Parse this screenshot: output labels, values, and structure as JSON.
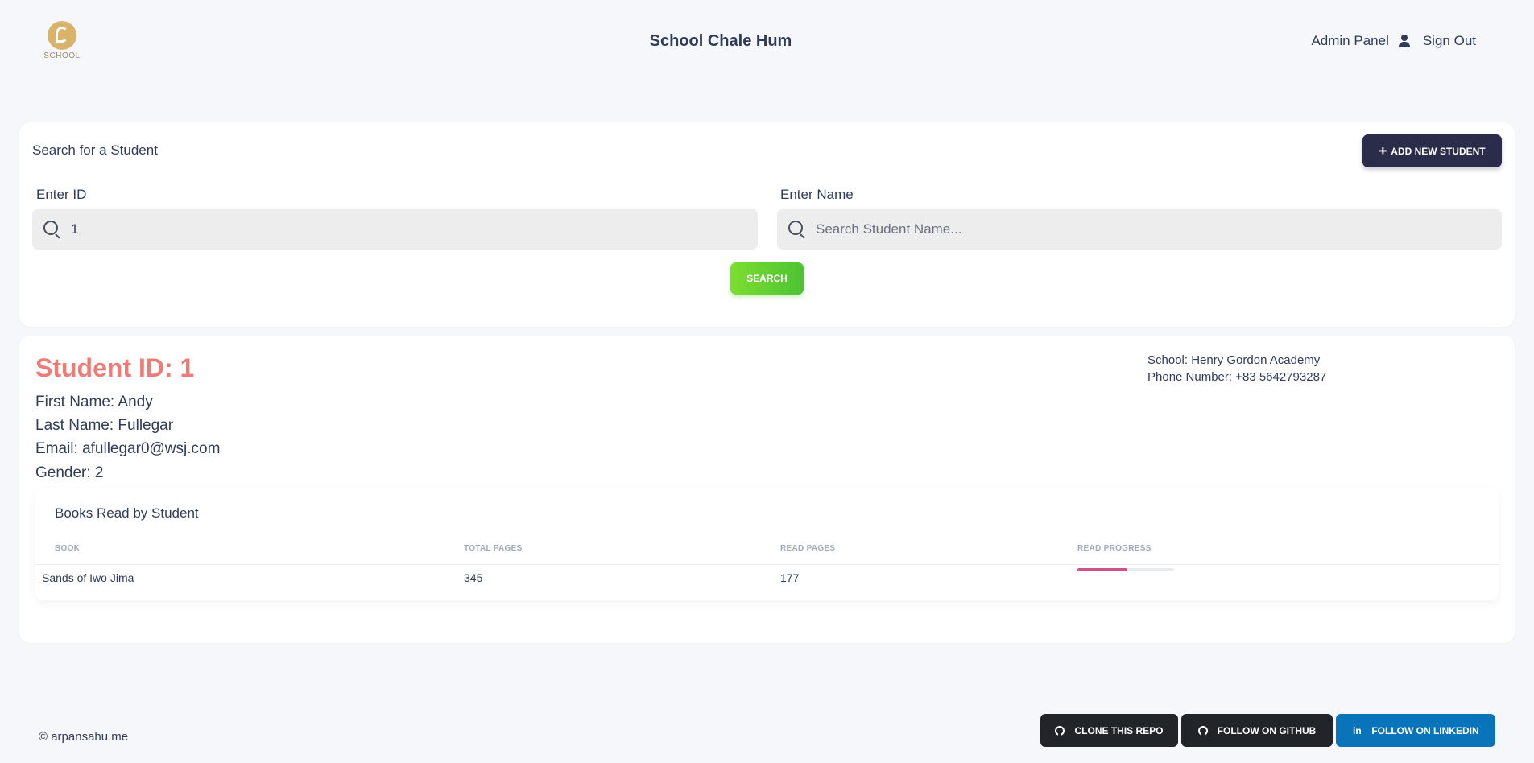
{
  "header": {
    "logo_text": "SCHOOL",
    "title": "School Chale Hum",
    "admin_panel": "Admin Panel",
    "sign_out": "Sign Out"
  },
  "search": {
    "heading": "Search for a Student",
    "add_button": "ADD NEW STUDENT",
    "id_label": "Enter ID",
    "id_value": "1",
    "name_label": "Enter Name",
    "name_value": "",
    "name_placeholder": "Search Student Name...",
    "search_button": "SEARCH"
  },
  "student": {
    "id_heading": "Student ID: 1",
    "first_name": "First Name: Andy",
    "last_name": "Last Name: Fullegar",
    "email": "Email: afullegar0@wsj.com",
    "gender": "Gender: 2",
    "school": "School: Henry Gordon Academy",
    "phone": "Phone Number: +83 5642793287"
  },
  "books": {
    "title": "Books Read by Student",
    "columns": [
      "BOOK",
      "TOTAL PAGES",
      "READ PAGES",
      "READ PROGRESS"
    ],
    "rows": [
      {
        "book": "Sands of Iwo Jima",
        "total_pages": "345",
        "read_pages": "177",
        "progress": 0.513
      }
    ]
  },
  "footer": {
    "copyright": "© arpansahu.me",
    "clone_repo": "CLONE THIS REPO",
    "follow_github": "FOLLOW ON GITHUB",
    "follow_linkedin": "FOLLOW ON LINKEDIN"
  },
  "colors": {
    "accent_dark": "#2a2c4a",
    "search_green": "#4cc234",
    "student_id_red": "#ee7b76",
    "progress_pink": "#d0508a",
    "linkedin_blue": "#0a74ba"
  }
}
